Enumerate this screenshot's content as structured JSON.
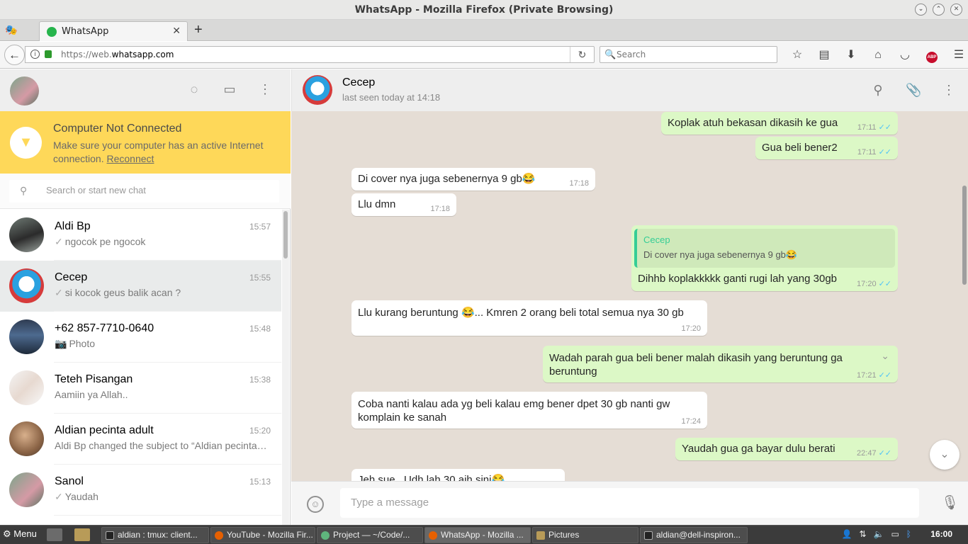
{
  "window": {
    "title": "WhatsApp - Mozilla Firefox (Private Browsing)"
  },
  "browser": {
    "tab_title": "WhatsApp",
    "url_prefix": "https://web.",
    "url_domain": "whatsapp.com",
    "search_placeholder": "Search"
  },
  "sidebar": {
    "notice": {
      "title": "Computer Not Connected",
      "text": "Make sure your computer has an active Internet connection.",
      "link": "Reconnect"
    },
    "search_placeholder": "Search or start new chat",
    "chats": [
      {
        "name": "Aldi Bp",
        "time": "15:57",
        "last": "ngocok pe ngocok",
        "tick": "✓"
      },
      {
        "name": "Cecep",
        "time": "15:55",
        "last": "si kocok geus balik acan ?",
        "tick": "✓"
      },
      {
        "name": "+62 857-7710-0640",
        "time": "15:48",
        "last": "Photo",
        "tick": "📷"
      },
      {
        "name": "Teteh Pisangan",
        "time": "15:38",
        "last": "Aamiin ya Allah..",
        "tick": ""
      },
      {
        "name": "Aldian pecinta adult",
        "time": "15:20",
        "last": "Aldi Bp changed the subject to “Aldian pecinta adult”",
        "tick": ""
      },
      {
        "name": "Sanol",
        "time": "15:13",
        "last": "Yaudah",
        "tick": "✓"
      }
    ]
  },
  "conversation": {
    "name": "Cecep",
    "status": "last seen today at 14:18",
    "messages": [
      {
        "text": "Koplak atuh bekasan dikasih ke gua",
        "time": "17:11",
        "receipt": "✓✓"
      },
      {
        "text": "Gua beli bener2",
        "time": "17:11",
        "receipt": "✓✓"
      },
      {
        "text": "Di cover nya juga sebenernya 9 gb😂",
        "time": "17:18"
      },
      {
        "text": "Llu dmn",
        "time": "17:18"
      },
      {
        "quote_name": "Cecep",
        "quote_text": "Di cover nya juga sebenernya 9 gb😂",
        "text": "Dihhb koplakkkkk ganti rugi lah yang 30gb",
        "time": "17:20",
        "receipt": "✓✓"
      },
      {
        "text": "Llu kurang beruntung 😂... Kmren 2 orang beli total semua nya 30 gb",
        "time": "17:20"
      },
      {
        "text": "Wadah parah gua beli bener malah dikasih yang beruntung ga",
        "text2": "beruntung",
        "time": "17:21",
        "receipt": "✓✓"
      },
      {
        "text": "Coba nanti kalau ada yg beli kalau emg bener dpet 30 gb nanti gw",
        "text2": "komplain ke sanah",
        "time": "17:24"
      },
      {
        "text": "Yaudah gua ga bayar dulu berati",
        "time": "22:47",
        "receipt": "✓✓"
      },
      {
        "text": "Jeh sue.. Udh lah 30 aih sini😂",
        "time": ""
      }
    ],
    "input_placeholder": "Type a message"
  },
  "taskbar": {
    "menu": "Menu",
    "tasks": [
      "aldian : tmux: client...",
      "YouTube - Mozilla Fir...",
      "Project — ~/Code/...",
      "WhatsApp - Mozilla ...",
      "Pictures",
      "aldian@dell-inspiron..."
    ],
    "clock": "16:00"
  },
  "colors": {
    "notice_bg": "#fed859",
    "outgoing_bubble": "#dcf8c6",
    "read_receipt": "#4fc3f7",
    "chat_bg": "#e5ddd5"
  }
}
